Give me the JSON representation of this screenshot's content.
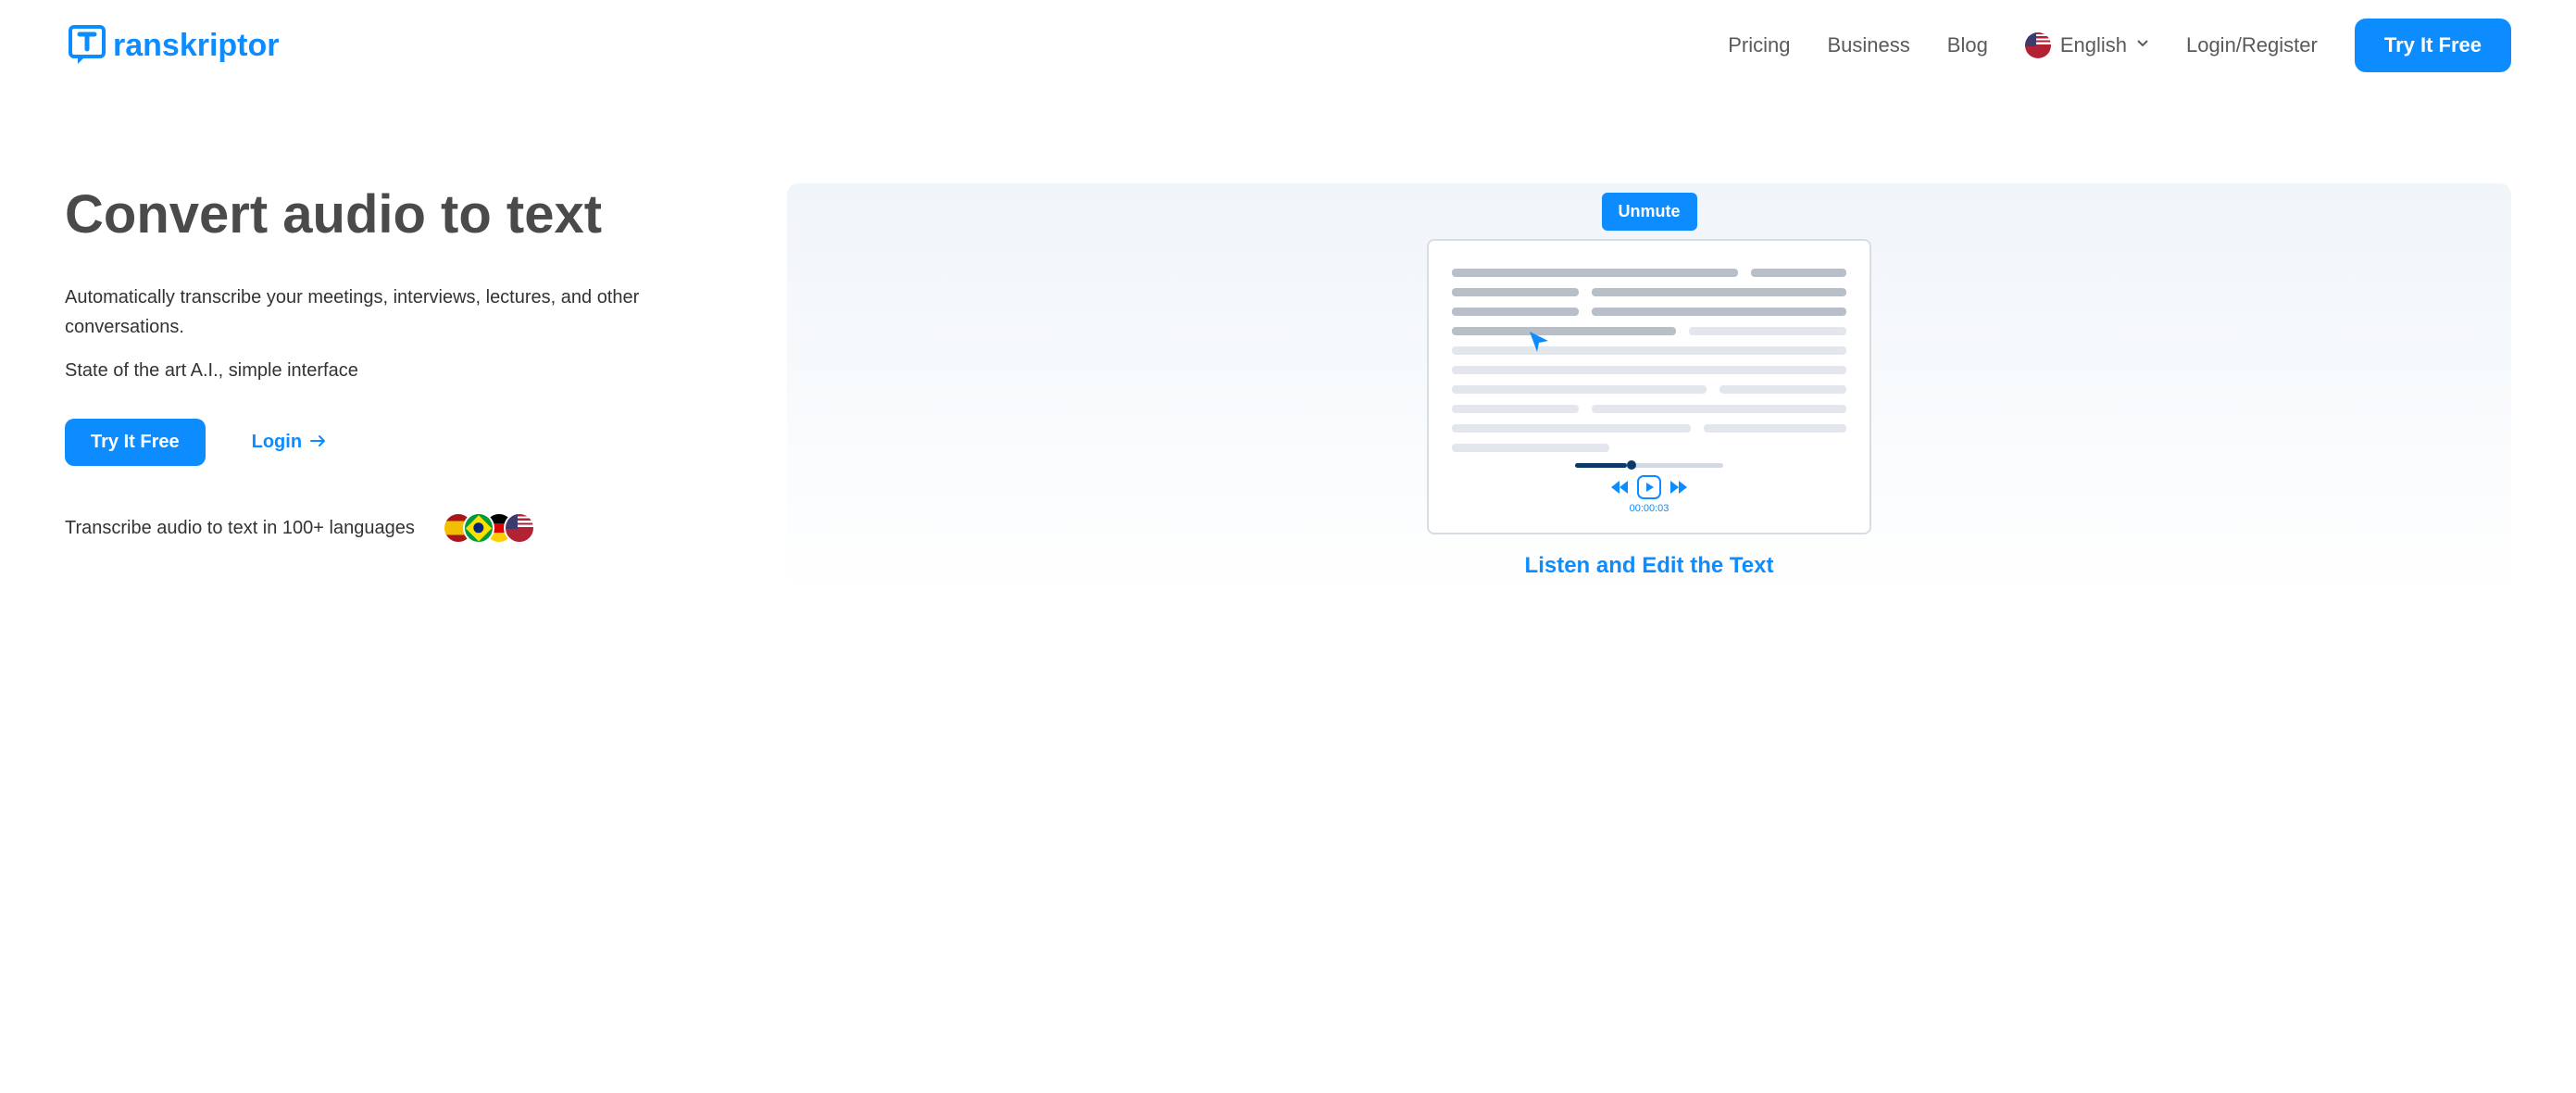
{
  "header": {
    "logo_text": "ranskriptor",
    "nav": {
      "pricing": "Pricing",
      "business": "Business",
      "blog": "Blog",
      "login_register": "Login/Register"
    },
    "language": {
      "label": "English"
    },
    "cta_button": "Try It Free"
  },
  "hero": {
    "title": "Convert audio to text",
    "description": "Automatically transcribe your meetings, interviews, lectures, and other conversations.",
    "description2": "State of the art A.I., simple interface",
    "cta_button": "Try It Free",
    "login_link": "Login",
    "languages_text": "Transcribe audio to text in 100+ languages"
  },
  "preview": {
    "unmute_button": "Unmute",
    "player_time": "00:00:03",
    "caption": "Listen and Edit the Text"
  }
}
